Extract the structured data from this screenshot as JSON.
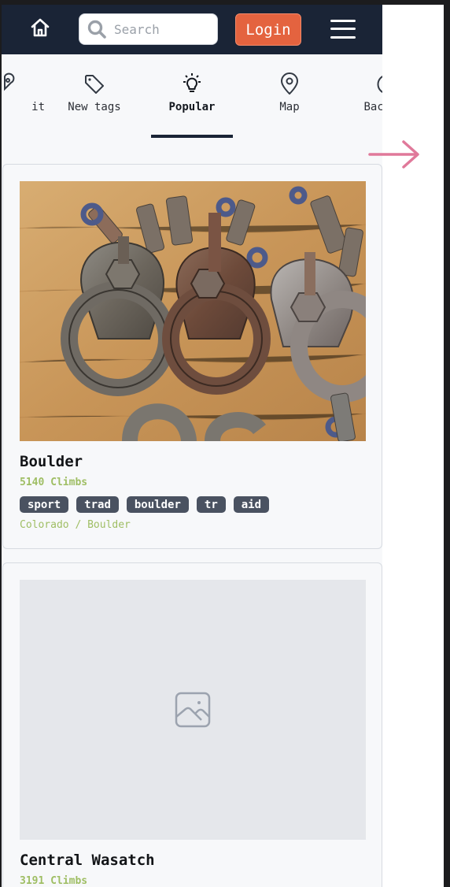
{
  "header": {
    "search_placeholder": "Search",
    "login_label": "Login"
  },
  "tabs": [
    {
      "label": "it",
      "icon": "map-pin-icon"
    },
    {
      "label": "New tags",
      "icon": "tag-icon"
    },
    {
      "label": "Popular",
      "icon": "lightbulb-icon",
      "active": true
    },
    {
      "label": "Map",
      "icon": "map-marker-icon"
    },
    {
      "label": "Backers",
      "icon": "dollar-circle-icon"
    }
  ],
  "cards": [
    {
      "name": "Boulder",
      "climbs": "5140 Climbs",
      "tags": [
        "sport",
        "trad",
        "boulder",
        "tr",
        "aid"
      ],
      "location": "Colorado / Boulder"
    },
    {
      "name": "Central Wasatch",
      "climbs": "3191 Climbs"
    }
  ],
  "colors": {
    "header_bg": "#1a2436",
    "login_bg": "#e4633f",
    "tag_bg": "#4a5261",
    "green_text": "#9fbe64",
    "arrow": "#e0799a"
  }
}
